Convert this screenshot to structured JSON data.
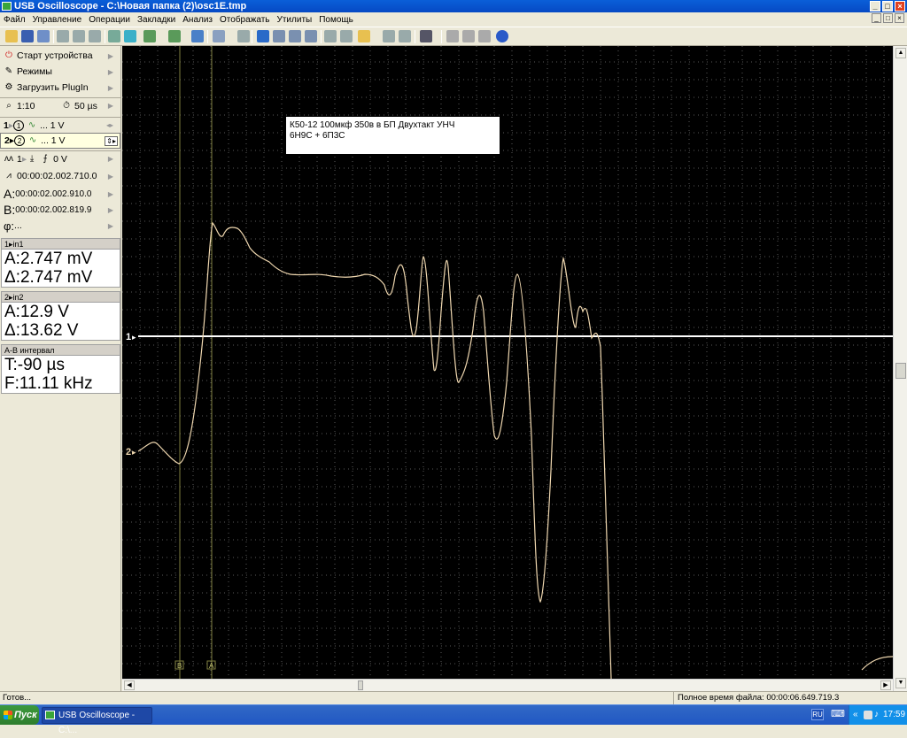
{
  "window": {
    "title": "USB Oscilloscope - C:\\Новая папка (2)\\osc1E.tmp"
  },
  "menu": [
    "Файл",
    "Управление",
    "Операции",
    "Закладки",
    "Анализ",
    "Отображать",
    "Утилиты",
    "Помощь"
  ],
  "left": {
    "start": "Старт устройства",
    "modes": "Режимы",
    "plugin": "Загрузить PlugIn",
    "zoom": "1:10",
    "timebase": "50 µs",
    "ch1": "... 1 V",
    "ch2": "... 1 V",
    "trigger": "0 V",
    "time0": "00:00:02.002.710.0",
    "a_time": "00:00:02.002.910.0",
    "b_time": "00:00:02.002.819.9",
    "phi": "...",
    "labels": {
      "ch1": "1",
      "ch2": "2",
      "trig_ch": "1",
      "a": "A:",
      "b": "B:",
      "phi": "φ:"
    }
  },
  "measure": {
    "in1": {
      "header": "in1",
      "a": "A:2.747 mV",
      "d": "Δ:2.747 mV"
    },
    "in2": {
      "header": "in2",
      "a": "A:12.9 V",
      "d": "Δ:13.62 V"
    },
    "ab": {
      "header": "A-B интервал",
      "t": "T:-90 µs",
      "f": "F:11.11 kHz"
    }
  },
  "scope": {
    "note_line1": "К50-12  100мкф 350в  в БП  Двухтакт  УНЧ",
    "note_line2": "6Н9С + 6П3С",
    "ch1_marker": "1",
    "ch2_marker": "2",
    "cursor_a": "A",
    "cursor_b": "B",
    "colors": {
      "bg": "#000000",
      "grid": "#5a5a5a",
      "ch1": "#ffffff",
      "ch2": "#f0d8b0",
      "cursor": "#808040"
    }
  },
  "status": {
    "left": "Готов...",
    "right": "Полное время файла: 00:00:06.649.719.3"
  },
  "taskbar": {
    "start": "Пуск",
    "task": "USB Oscilloscope - C:\\...",
    "lang": "RU",
    "time": "17:59"
  }
}
